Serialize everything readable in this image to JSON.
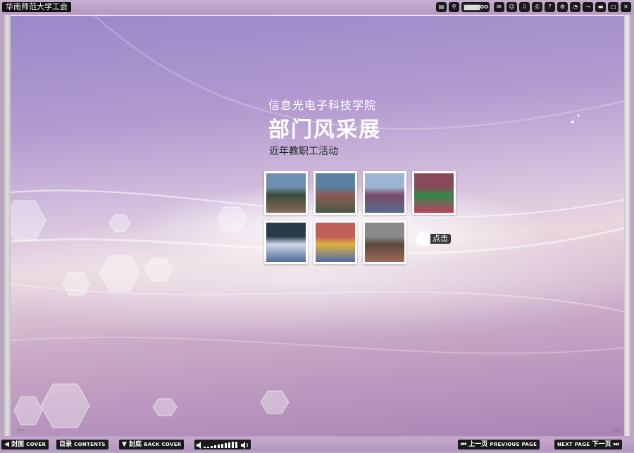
{
  "window": {
    "title": "华南师范大学工会"
  },
  "toolbar": {
    "go_label": "GO",
    "buttons": [
      "thumbnail-icon",
      "search-icon",
      "comment-icon",
      "user-icon",
      "download-icon",
      "print-icon",
      "help-icon",
      "settings-icon",
      "autoplay-icon",
      "share-icon",
      "minimize-icon",
      "maximize-icon",
      "close-icon"
    ]
  },
  "page": {
    "subtitle": "信息光电子科技学院",
    "title": "部门风采展",
    "caption": "近年教职工活动",
    "photos": [
      {
        "name": "photo-1",
        "colors": [
          "#6f8fb0",
          "#3a4a3a",
          "#8a6a5a"
        ]
      },
      {
        "name": "photo-2",
        "colors": [
          "#5a7fa0",
          "#8c5a52",
          "#4a5a4a"
        ]
      },
      {
        "name": "photo-3",
        "colors": [
          "#9bb6d2",
          "#7a4a6a",
          "#5a6a8a"
        ]
      },
      {
        "name": "photo-4",
        "colors": [
          "#8a4a5a",
          "#2f8a4a",
          "#c04060"
        ]
      },
      {
        "name": "photo-5",
        "colors": [
          "#2a3a4a",
          "#d0d8e8",
          "#4a6a9a"
        ]
      },
      {
        "name": "photo-6",
        "colors": [
          "#c0605a",
          "#e0b040",
          "#4a6ab0"
        ]
      },
      {
        "name": "photo-7",
        "colors": [
          "#8a8a8a",
          "#5a4a3a",
          "#a06a5a"
        ]
      }
    ],
    "click_label": "点击",
    "left_page_number": "- 27 -",
    "right_page_number": "- 28 -"
  },
  "bottombar": {
    "cover_cn": "封面",
    "cover_en": "COVER",
    "contents_cn": "目录",
    "contents_en": "CONTENTS",
    "back_cover_cn": "封底",
    "back_cover_en": "BACK COVER",
    "prev_cn": "上一页",
    "prev_en": "PREVIOUS PAGE",
    "next_en": "NEXT PAGE",
    "next_cn": "下一页"
  },
  "colors": {
    "bar": "#1a1a1a",
    "accent": "#b79ac2"
  }
}
